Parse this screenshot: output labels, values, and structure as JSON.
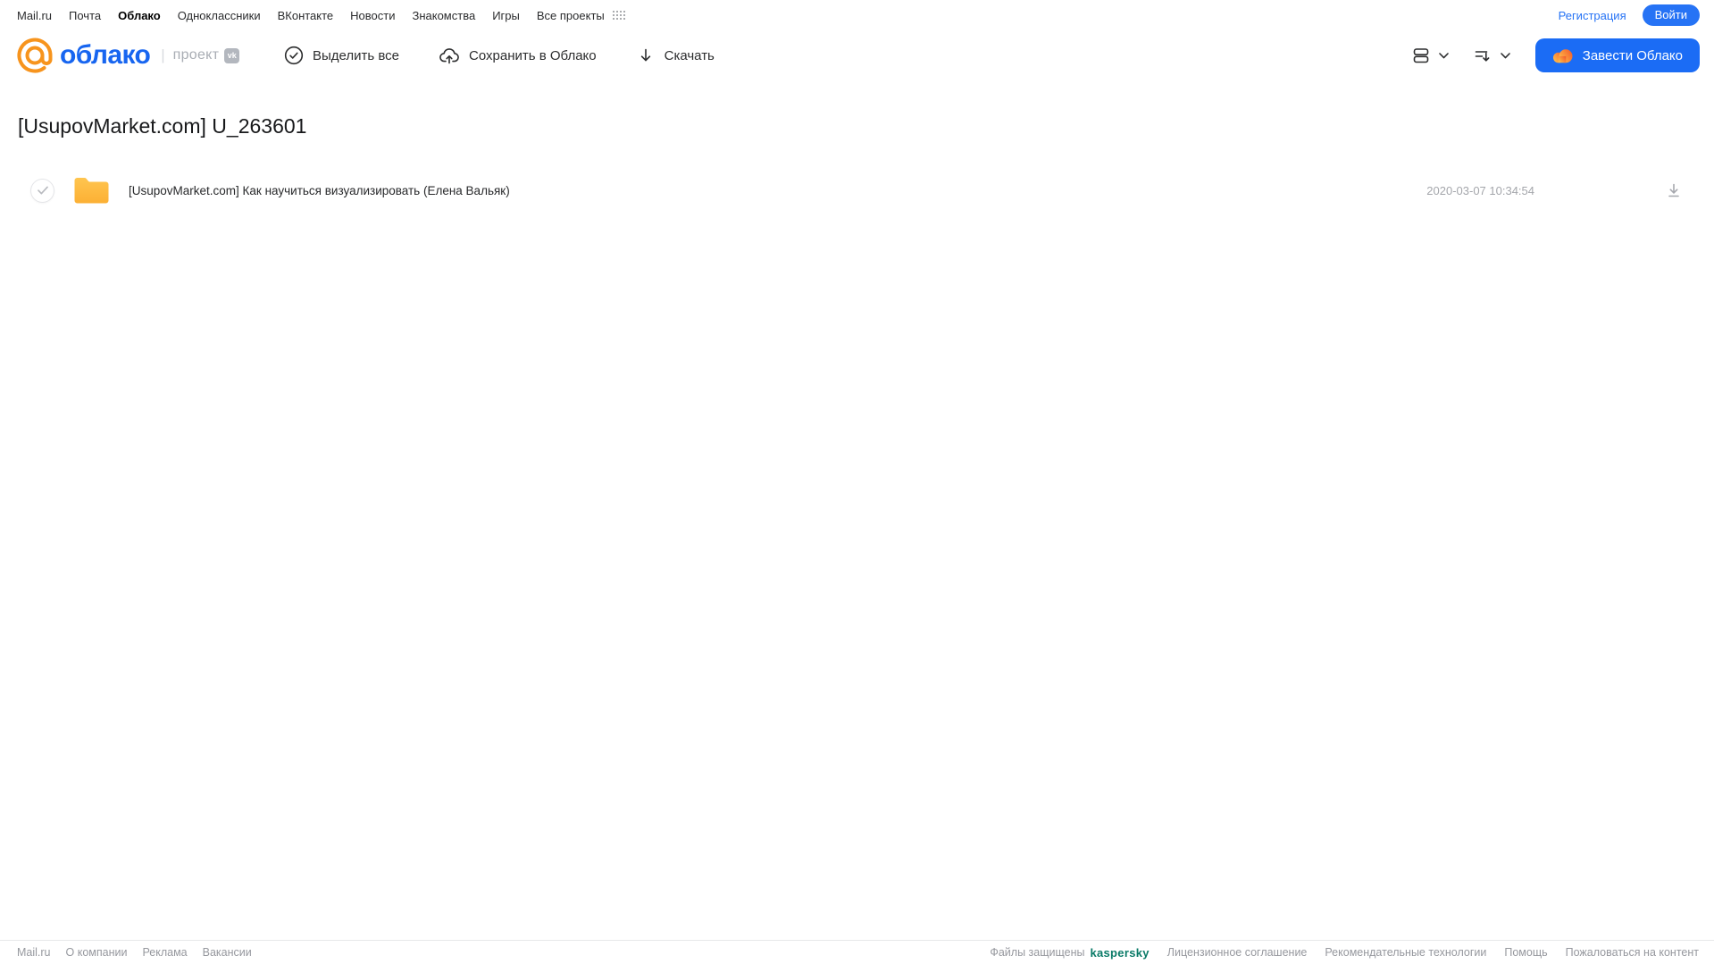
{
  "top_nav": {
    "links": [
      {
        "label": "Mail.ru",
        "active": false
      },
      {
        "label": "Почта",
        "active": false
      },
      {
        "label": "Облако",
        "active": true
      },
      {
        "label": "Одноклассники",
        "active": false
      },
      {
        "label": "ВКонтакте",
        "active": false
      },
      {
        "label": "Новости",
        "active": false
      },
      {
        "label": "Знакомства",
        "active": false
      },
      {
        "label": "Игры",
        "active": false
      },
      {
        "label": "Все проекты",
        "active": false
      }
    ],
    "registration_label": "Регистрация",
    "login_label": "Войти"
  },
  "header": {
    "logo_text": "облако",
    "project_label": "проект",
    "vk_badge": "vk",
    "toolbar": {
      "select_all": "Выделить все",
      "save_to_cloud": "Сохранить в Облако",
      "download": "Скачать"
    },
    "get_cloud_label": "Завести Облако"
  },
  "main": {
    "title": "[UsupovMarket.com] U_263601",
    "files": [
      {
        "type": "folder",
        "name": "[UsupovMarket.com] Как научиться визуализировать (Елена Вальяк)",
        "date": "2020-03-07 10:34:54"
      }
    ]
  },
  "footer": {
    "left_links": [
      "Mail.ru",
      "О компании",
      "Реклама",
      "Вакансии"
    ],
    "protected_label": "Файлы защищены",
    "kaspersky_label": "kaspersky",
    "right_links": [
      "Лицензионное соглашение",
      "Рекомендательные технологии",
      "Помощь",
      "Пожаловаться на контент"
    ]
  },
  "colors": {
    "accent_blue": "#1b6cf5",
    "logo_orange": "#f7941d",
    "logo_blue": "#1765f0",
    "kaspersky_green": "#097a67",
    "folder_yellow": "#ffb83d"
  }
}
